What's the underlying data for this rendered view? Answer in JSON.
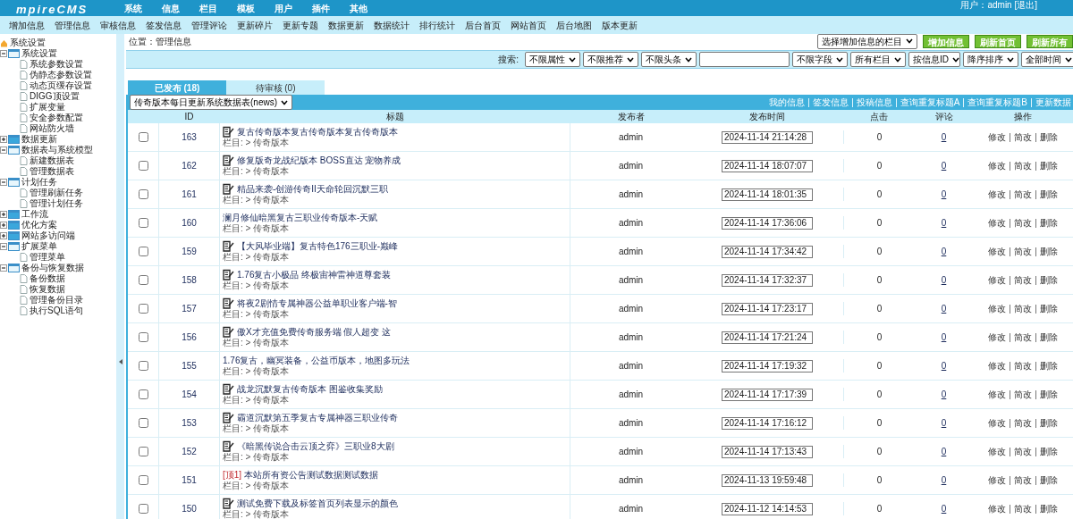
{
  "header": {
    "logo": "mpireCMS",
    "nav": [
      "系统",
      "信息",
      "栏目",
      "模板",
      "用户",
      "插件",
      "其他"
    ],
    "user": "用户：admin [退出]"
  },
  "submenu": [
    "增加信息",
    "管理信息",
    "审核信息",
    "签发信息",
    "管理评论",
    "更新碎片",
    "更新专题",
    "数据更新",
    "数据统计",
    "排行统计",
    "后台首页",
    "网站首页",
    "后台地图",
    "版本更新"
  ],
  "sidebar": {
    "root": "系统设置",
    "tree": [
      {
        "label": "系统设置",
        "expanded": true,
        "children": [
          "系统参数设置",
          "伪静态参数设置",
          "动态页缓存设置",
          "DIGG顶设置",
          "扩展变量",
          "安全参数配置",
          "网站防火墙"
        ]
      },
      {
        "label": "数据更新",
        "expanded": false
      },
      {
        "label": "数据表与系统模型",
        "expanded": true,
        "children": [
          "新建数据表",
          "管理数据表"
        ]
      },
      {
        "label": "计划任务",
        "expanded": true,
        "children": [
          "管理刷新任务",
          "管理计划任务"
        ]
      },
      {
        "label": "工作流",
        "expanded": false
      },
      {
        "label": "优化方案",
        "expanded": false
      },
      {
        "label": "网站多访问端",
        "expanded": false
      },
      {
        "label": "扩展菜单",
        "expanded": true,
        "children": [
          "管理菜单"
        ]
      },
      {
        "label": "备份与恢复数据",
        "expanded": true,
        "children": [
          "备份数据",
          "恢复数据",
          "管理备份目录",
          "执行SQL语句"
        ]
      }
    ]
  },
  "location": "位置：管理信息",
  "column_select": "选择增加信息的栏目",
  "buttons": [
    "增加信息",
    "刷新首页",
    "刷新所有"
  ],
  "search": {
    "label": "搜索:",
    "filters_before": [
      "不限属性",
      "不限推荐",
      "不限头条"
    ],
    "filters_after": [
      "不限字段",
      "所有栏目",
      "按信息ID",
      "降序排序",
      "全部时间"
    ]
  },
  "tabs": [
    {
      "label": "已发布 (18)",
      "selected": true
    },
    {
      "label": "待审核 (0)",
      "selected": false
    }
  ],
  "table_select": "传奇版本每日更新系统数据表(news)",
  "links": [
    "我的信息",
    "签发信息",
    "投稿信息",
    "查询重复标题A",
    "查询重复标题B",
    "更新数据"
  ],
  "table": {
    "columns": [
      "ID",
      "标题",
      "发布者",
      "发布时间",
      "点击",
      "评论",
      "操作"
    ],
    "rows": [
      {
        "checked": false,
        "id": "163",
        "edit_icon": true,
        "title": "复古传奇版本复古传奇版本复古传奇版本",
        "category": "栏目: > 传奇版本",
        "publisher": "admin",
        "time": "2024-11-14 21:14:28",
        "clicks": "0",
        "comments": "0",
        "actions": [
          "修改",
          "简改",
          "删除"
        ]
      },
      {
        "checked": false,
        "id": "162",
        "edit_icon": true,
        "title": "修复版奇龙战纪版本 BOSS直达 宠物养成",
        "category": "栏目: > 传奇版本",
        "publisher": "admin",
        "time": "2024-11-14 18:07:07",
        "clicks": "0",
        "comments": "0",
        "actions": [
          "修改",
          "简改",
          "删除"
        ]
      },
      {
        "checked": false,
        "id": "161",
        "edit_icon": true,
        "title": "精品来袭-创游传奇II天命轮回沉默三职",
        "category": "栏目: > 传奇版本",
        "publisher": "admin",
        "time": "2024-11-14 18:01:35",
        "clicks": "0",
        "comments": "0",
        "actions": [
          "修改",
          "简改",
          "删除"
        ]
      },
      {
        "checked": false,
        "id": "160",
        "edit_icon": false,
        "title": "澜月修仙暗黑复古三职业传奇版本-天赋",
        "category": "栏目: > 传奇版本",
        "publisher": "admin",
        "time": "2024-11-14 17:36:06",
        "clicks": "0",
        "comments": "0",
        "actions": [
          "修改",
          "简改",
          "删除"
        ]
      },
      {
        "checked": false,
        "id": "159",
        "edit_icon": true,
        "title": "【大风毕业端】复古特色176三职业-巅峰",
        "category": "栏目: > 传奇版本",
        "publisher": "admin",
        "time": "2024-11-14 17:34:42",
        "clicks": "0",
        "comments": "0",
        "actions": [
          "修改",
          "简改",
          "删除"
        ]
      },
      {
        "checked": false,
        "id": "158",
        "edit_icon": true,
        "title": "1.76复古小极品 终极宙神雷神道尊套装",
        "category": "栏目: > 传奇版本",
        "publisher": "admin",
        "time": "2024-11-14 17:32:37",
        "clicks": "0",
        "comments": "0",
        "actions": [
          "修改",
          "简改",
          "删除"
        ]
      },
      {
        "checked": false,
        "id": "157",
        "edit_icon": true,
        "title": "将夜2剧情专属神器公益单职业客户端-智",
        "category": "栏目: > 传奇版本",
        "publisher": "admin",
        "time": "2024-11-14 17:23:17",
        "clicks": "0",
        "comments": "0",
        "actions": [
          "修改",
          "简改",
          "删除"
        ]
      },
      {
        "checked": false,
        "id": "156",
        "edit_icon": true,
        "title": "傲X才充值免费传奇服务端 假人超变 这",
        "category": "栏目: > 传奇版本",
        "publisher": "admin",
        "time": "2024-11-14 17:21:24",
        "clicks": "0",
        "comments": "0",
        "actions": [
          "修改",
          "简改",
          "删除"
        ]
      },
      {
        "checked": false,
        "id": "155",
        "edit_icon": false,
        "title": "1.76复古，幽冥装备，公益币版本，地图多玩法",
        "category": "栏目: > 传奇版本",
        "publisher": "admin",
        "time": "2024-11-14 17:19:32",
        "clicks": "0",
        "comments": "0",
        "actions": [
          "修改",
          "简改",
          "删除"
        ]
      },
      {
        "checked": false,
        "id": "154",
        "edit_icon": true,
        "title": "战龙沉默复古传奇版本 图鉴收集奖励",
        "category": "栏目: > 传奇版本",
        "publisher": "admin",
        "time": "2024-11-14 17:17:39",
        "clicks": "0",
        "comments": "0",
        "actions": [
          "修改",
          "简改",
          "删除"
        ]
      },
      {
        "checked": false,
        "id": "153",
        "edit_icon": true,
        "title": "霸道沉默第五季复古专属神器三职业传奇",
        "category": "栏目: > 传奇版本",
        "publisher": "admin",
        "time": "2024-11-14 17:16:12",
        "clicks": "0",
        "comments": "0",
        "actions": [
          "修改",
          "简改",
          "删除"
        ]
      },
      {
        "checked": false,
        "id": "152",
        "edit_icon": true,
        "title": "《暗黑传说合击云顶之弈》三职业8大剧",
        "category": "栏目: > 传奇版本",
        "publisher": "admin",
        "time": "2024-11-14 17:13:43",
        "clicks": "0",
        "comments": "0",
        "actions": [
          "修改",
          "简改",
          "删除"
        ]
      },
      {
        "checked": false,
        "id": "151",
        "edit_icon": false,
        "top_tag": "[顶1]",
        "title": "本站所有资公告测试数据测试数据",
        "category": "栏目: > 传奇版本",
        "publisher": "admin",
        "time": "2024-11-13 19:59:48",
        "clicks": "0",
        "comments": "0",
        "actions": [
          "修改",
          "简改",
          "删除"
        ]
      },
      {
        "checked": false,
        "id": "150",
        "edit_icon": true,
        "title": "测试免费下载及标签首页列表显示的颜色",
        "category": "栏目: > 传奇版本",
        "publisher": "admin",
        "time": "2024-11-12 14:14:53",
        "clicks": "0",
        "comments": "0",
        "actions": [
          "修改",
          "简改",
          "删除"
        ]
      }
    ]
  }
}
